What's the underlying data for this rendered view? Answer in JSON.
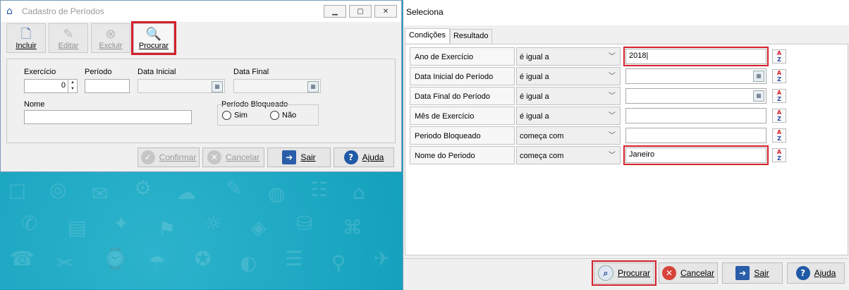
{
  "left_window": {
    "title": "Cadastro de Períodos",
    "toolbar": {
      "incluir": "Incluir",
      "editar": "Editar",
      "excluir": "Excluir",
      "procurar": "Procurar"
    },
    "form": {
      "exercicio_label": "Exercício",
      "exercicio_value": "0",
      "periodo_label": "Período",
      "data_inicial_label": "Data Inicial",
      "data_final_label": "Data Final",
      "nome_label": "Nome",
      "periodo_bloqueado_label": "Período Bloqueado",
      "sim_label": "Sim",
      "nao_label": "Não"
    },
    "buttons": {
      "confirmar": "Confirmar",
      "cancelar": "Cancelar",
      "sair": "Sair",
      "ajuda": "Ajuda"
    }
  },
  "right_window": {
    "title": "Seleciona",
    "tabs": [
      "Condições",
      "Resultado"
    ],
    "conditions": [
      {
        "field": "Ano de Exercício",
        "operator": "é igual a",
        "value": ""
      },
      {
        "field": "Data Inicial do Período",
        "operator": "é igual a",
        "value": ""
      },
      {
        "field": "Data Final do Período",
        "operator": "é igual a",
        "value": ""
      },
      {
        "field": "Mês de Exercício",
        "operator": "é igual a",
        "value": ""
      },
      {
        "field": "Periodo Bloqueado",
        "operator": "começa com",
        "value": ""
      },
      {
        "field": "Nome do Periodo",
        "operator": "começa com",
        "value": "Janeiro"
      }
    ],
    "ano_value": "2018",
    "buttons": {
      "procurar": "Procurar",
      "cancelar": "Cancelar",
      "sair": "Sair",
      "ajuda": "Ajuda"
    }
  },
  "colors": {
    "highlight_red": "#d3202b",
    "desktop_teal": "#0b8fae",
    "help_blue": "#1f5aa6"
  }
}
